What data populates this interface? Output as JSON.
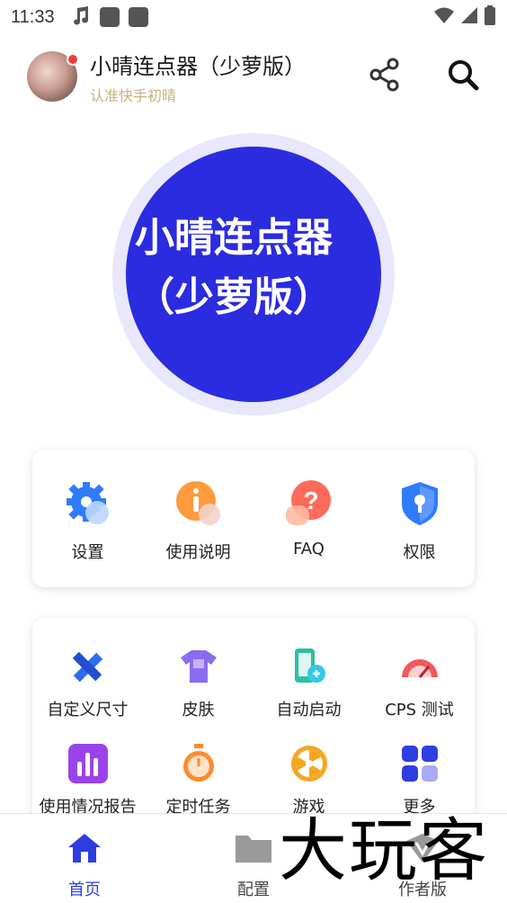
{
  "status_bar": {
    "time": "11:33"
  },
  "header": {
    "title": "小晴连点器（少萝版）",
    "subtitle": "认准快手初晴"
  },
  "main_button": {
    "line1": "小晴连点器",
    "line2": "（少萝版）"
  },
  "card1": {
    "items": [
      {
        "label": "设置",
        "icon": "gear-icon"
      },
      {
        "label": "使用说明",
        "icon": "info-icon"
      },
      {
        "label": "FAQ",
        "icon": "question-icon"
      },
      {
        "label": "权限",
        "icon": "shield-icon"
      }
    ]
  },
  "card2": {
    "items": [
      {
        "label": "自定义尺寸",
        "icon": "ruler-pencil-icon"
      },
      {
        "label": "皮肤",
        "icon": "tshirt-icon"
      },
      {
        "label": "自动启动",
        "icon": "phone-link-icon"
      },
      {
        "label": "CPS 测试",
        "icon": "speedometer-icon"
      },
      {
        "label": "使用情况报告",
        "icon": "bar-chart-icon"
      },
      {
        "label": "定时任务",
        "icon": "stopwatch-icon"
      },
      {
        "label": "游戏",
        "icon": "wheel-icon"
      },
      {
        "label": "更多",
        "icon": "grid-icon"
      }
    ]
  },
  "bottom_nav": {
    "items": [
      {
        "label": "首页",
        "icon": "home-icon",
        "active": true
      },
      {
        "label": "配置",
        "icon": "folder-icon",
        "active": false
      },
      {
        "label": "作者版",
        "icon": "vip-icon",
        "active": false
      }
    ]
  },
  "watermark": "大玩客",
  "colors": {
    "accent": "#2d3ee0",
    "primary_button": "#2b2be0",
    "subtitle": "#c6b37a"
  }
}
